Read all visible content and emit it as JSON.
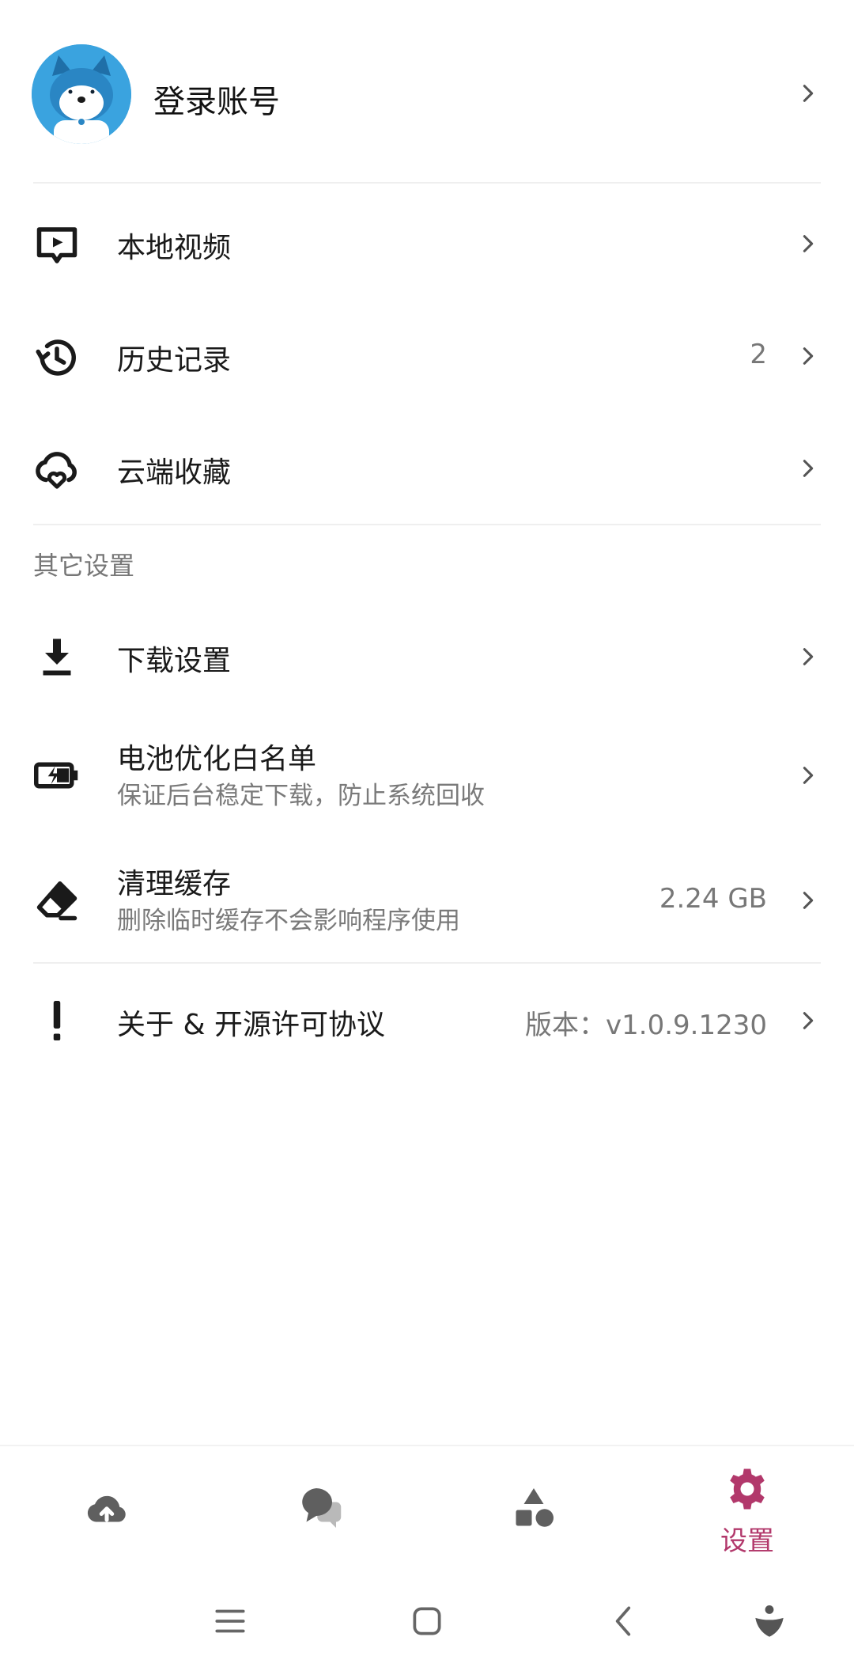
{
  "account": {
    "label": "登录账号"
  },
  "menu": {
    "local_videos": {
      "title": "本地视频"
    },
    "history": {
      "title": "历史记录",
      "value": "2"
    },
    "cloud_favorites": {
      "title": "云端收藏"
    }
  },
  "other_settings": {
    "header": "其它设置",
    "download": {
      "title": "下载设置"
    },
    "battery": {
      "title": "电池优化白名单",
      "subtitle": "保证后台稳定下载，防止系统回收"
    },
    "cache": {
      "title": "清理缓存",
      "subtitle": "删除临时缓存不会影响程序使用",
      "value": "2.24 GB"
    },
    "about": {
      "title": "关于 & 开源许可协议",
      "value": "版本：v1.0.9.1230"
    }
  },
  "bottom_nav": {
    "items": [
      {
        "icon": "cloud-upload-icon",
        "label": ""
      },
      {
        "icon": "chat-bubbles-icon",
        "label": ""
      },
      {
        "icon": "shapes-icon",
        "label": ""
      },
      {
        "icon": "gear-icon",
        "label": "设置"
      }
    ],
    "active_index": 3,
    "active_color": "#b2386b",
    "inactive_color": "#5f5f5f"
  },
  "system_nav": {
    "buttons": [
      "menu-icon",
      "home-icon",
      "back-icon",
      "assistant-icon"
    ]
  }
}
